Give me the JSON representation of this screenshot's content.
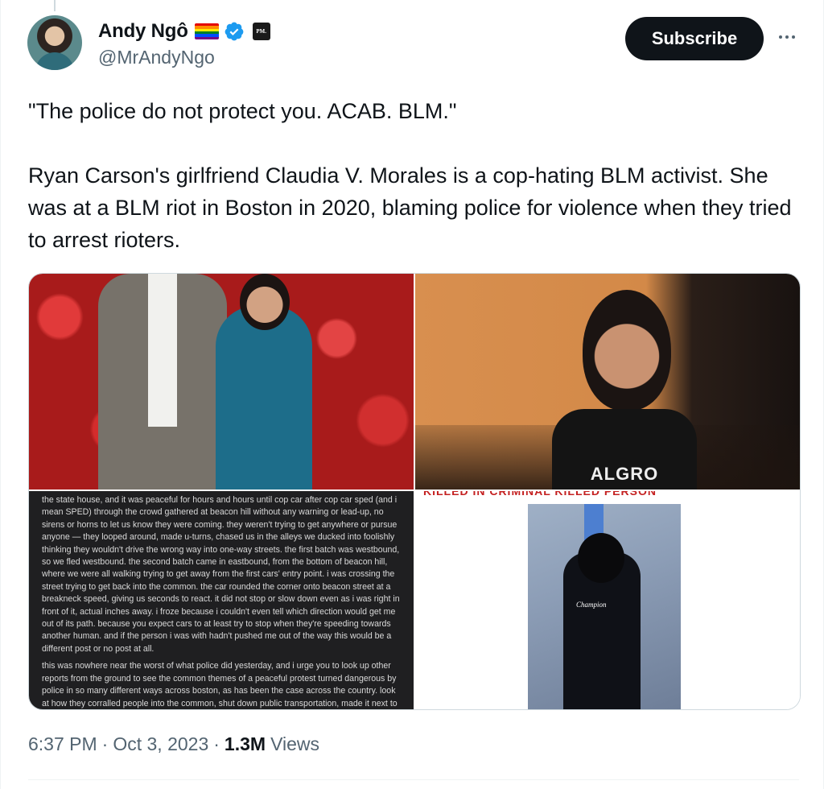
{
  "author": {
    "display_name": "Andy Ngô",
    "handle": "@MrAndyNgo",
    "org_badge_text": "PM.",
    "badges": [
      "rainbow-flag-icon",
      "verified-badge-icon",
      "org-affiliation-icon"
    ]
  },
  "actions": {
    "subscribe_label": "Subscribe",
    "more_icon": "more-horizontal-icon"
  },
  "tweet": {
    "paragraph_1": "\"The police do not protect you. ACAB. BLM.\"",
    "paragraph_2": "Ryan Carson's girlfriend Claudia V. Morales is a cop-hating BLM activist. She was at a BLM riot in Boston in 2020, blaming police for violence when they tried to arrest rioters."
  },
  "media": {
    "tile_2_shirt_text": "ALGRO",
    "tile_3_text_1": "the state house, and it was peaceful for hours and hours until cop car after cop car sped (and i mean SPED) through the crowd gathered at beacon hill without any warning or lead-up, no sirens or horns to let us know they were coming. they weren't trying to get anywhere or pursue anyone — they looped around, made u-turns, chased us in the alleys we ducked into foolishly thinking they wouldn't drive the wrong way into one-way streets. the first batch was westbound, so we fled westbound. the second batch came in eastbound, from the bottom of beacon hill, where we were all walking trying to get away from the first cars' entry point. i was crossing the street trying to get back into the common. the car rounded the corner onto beacon street at a breakneck speed, giving us seconds to react. it did not stop or slow down even as i was right in front of it, actual inches away. i froze because i couldn't even tell which direction would get me out of its path. because you expect cars to at least try to stop when they're speeding towards another human. and if the person i was with hadn't pushed me out of the way this would be a different post or no post at all.",
    "tile_3_text_2": "this was nowhere near the worst of what police did yesterday, and i urge you to look up other reports from the ground to see the common themes of a peaceful protest turned dangerous by police in so many different ways across boston, as has been the case across the country. look at how they corralled people into the common, shut down public transportation, made it next to impossible to get out, and got violent. how they delight in maiming the civilians they pretend to protect.",
    "tile_4_banner": "KILLED IN CRIMINAL KILLED PERSON",
    "tile_4_logo": "Champion"
  },
  "meta": {
    "time": "6:37 PM",
    "date": "Oct 3, 2023",
    "separator": "·",
    "views_count": "1.3M",
    "views_label": "Views"
  },
  "colors": {
    "text_primary": "#0f1419",
    "text_secondary": "#536471",
    "verified_blue": "#1d9bf0",
    "border": "#cfd9de"
  }
}
